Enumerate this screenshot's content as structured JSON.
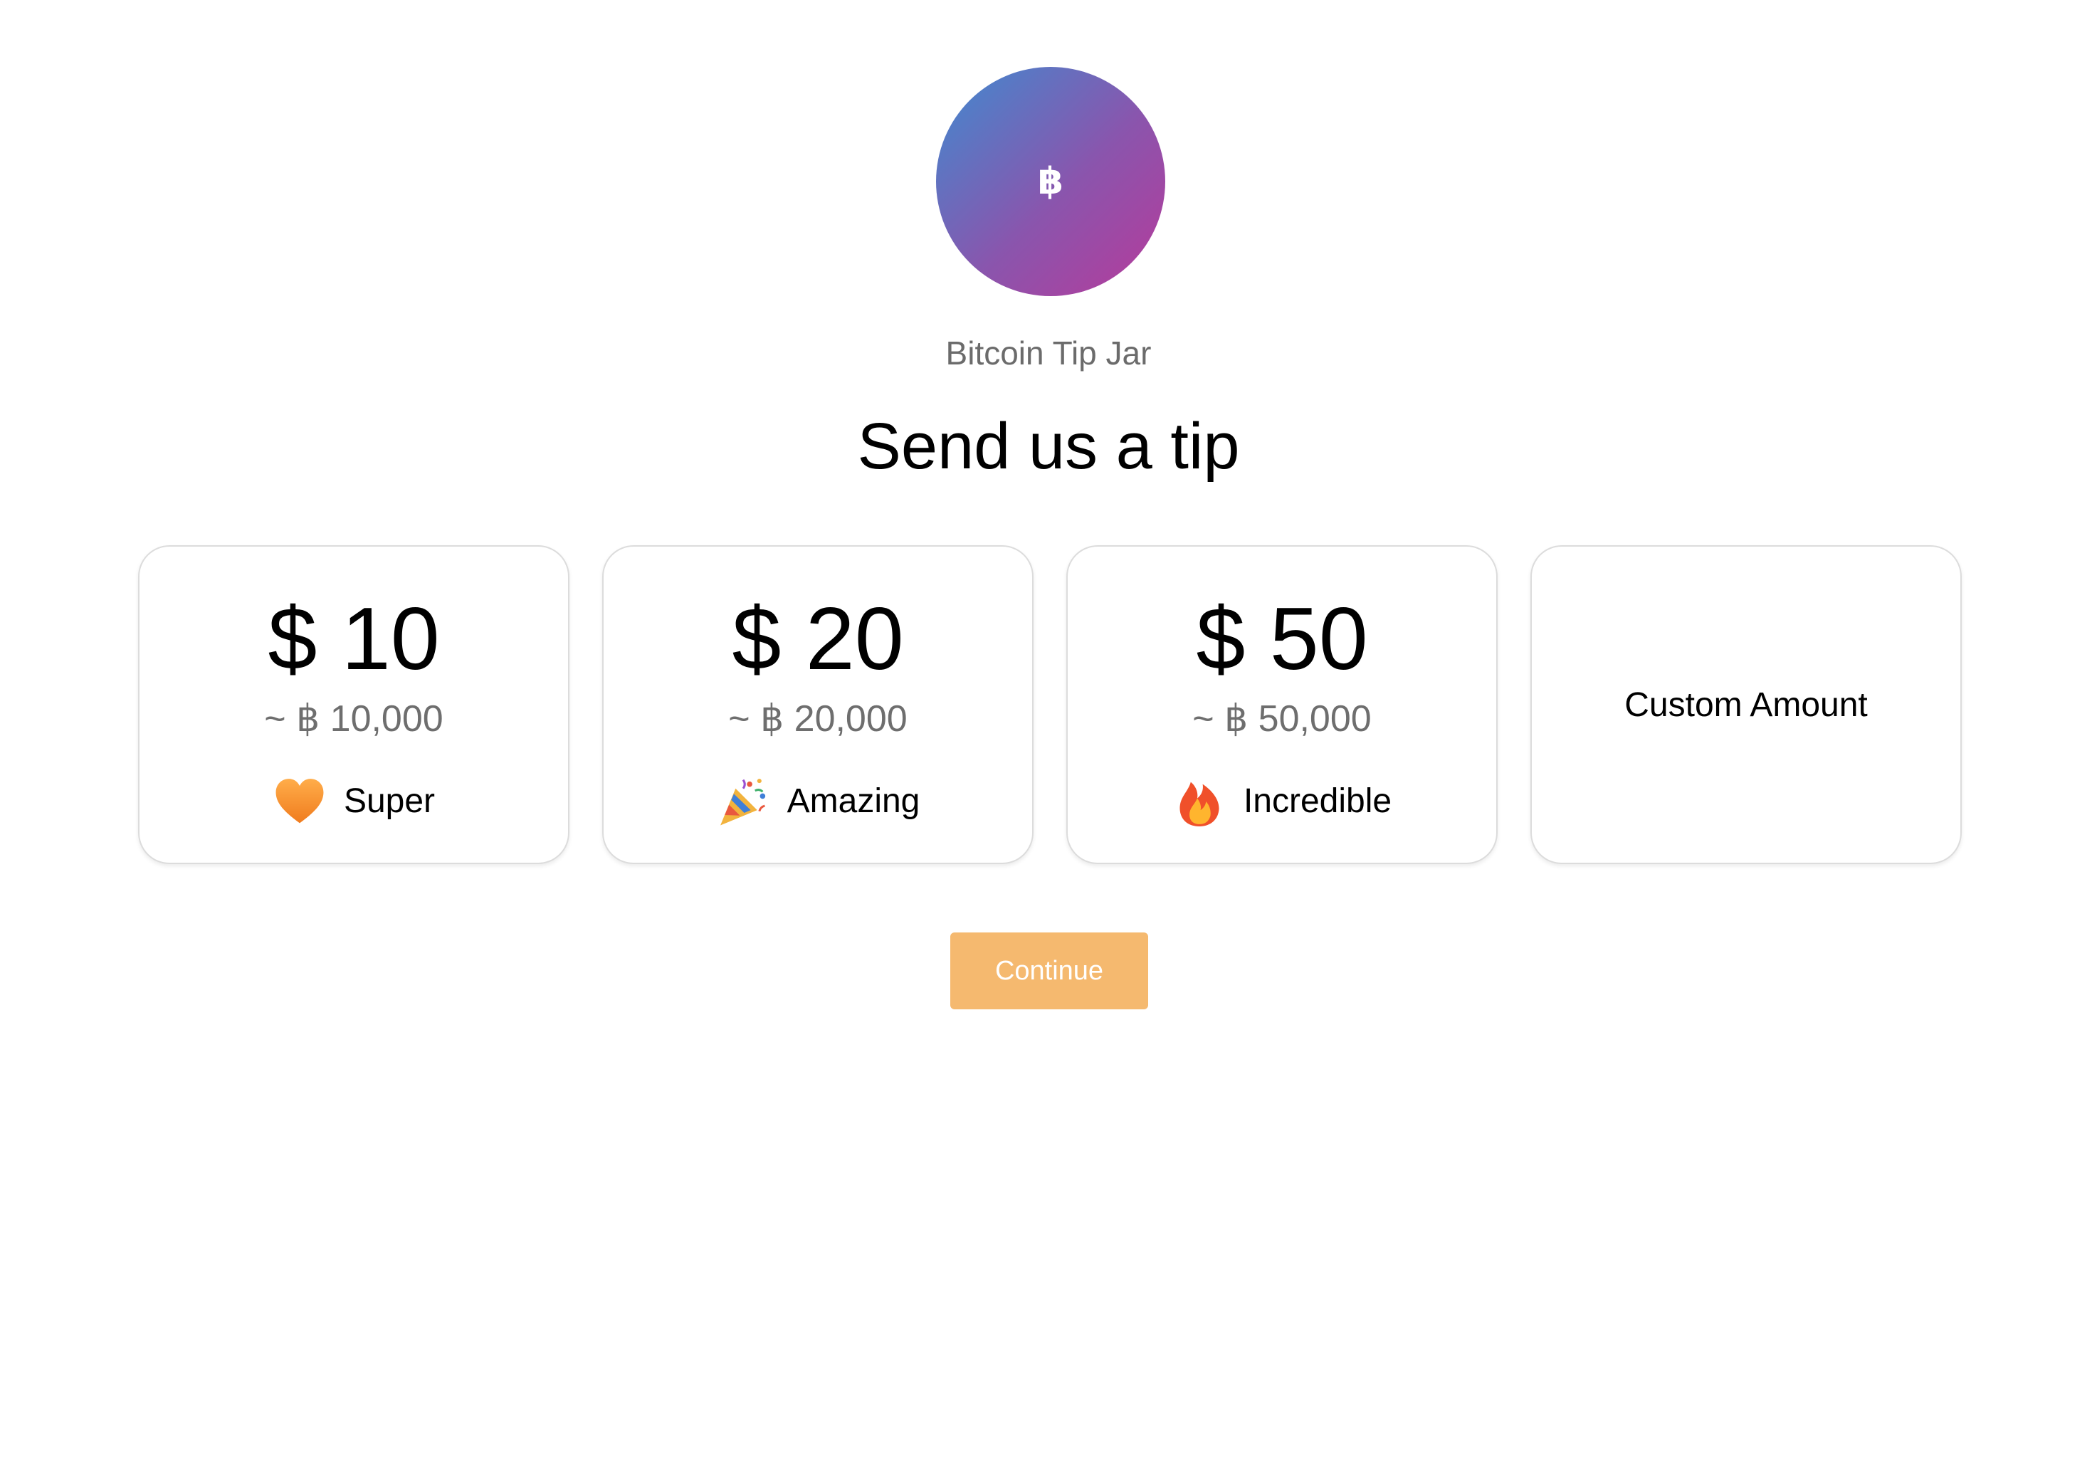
{
  "brand": {
    "avatar_symbol": "฿",
    "avatar_gradient": [
      "#3f8bd0",
      "#b73a9a"
    ],
    "name": "Bitcoin Tip Jar"
  },
  "heading": "Send us a tip",
  "options": [
    {
      "amount": "$ 10",
      "btc": "~ ฿ 10,000",
      "icon": "orange-heart-icon",
      "label": "Super"
    },
    {
      "amount": "$ 20",
      "btc": "~ ฿ 20,000",
      "icon": "party-popper-icon",
      "label": "Amazing"
    },
    {
      "amount": "$ 50",
      "btc": "~ ฿ 50,000",
      "icon": "fire-icon",
      "label": "Incredible"
    }
  ],
  "custom": {
    "label": "Custom Amount"
  },
  "continue_button": {
    "label": "Continue",
    "color": "#f5b96f",
    "enabled": false
  }
}
